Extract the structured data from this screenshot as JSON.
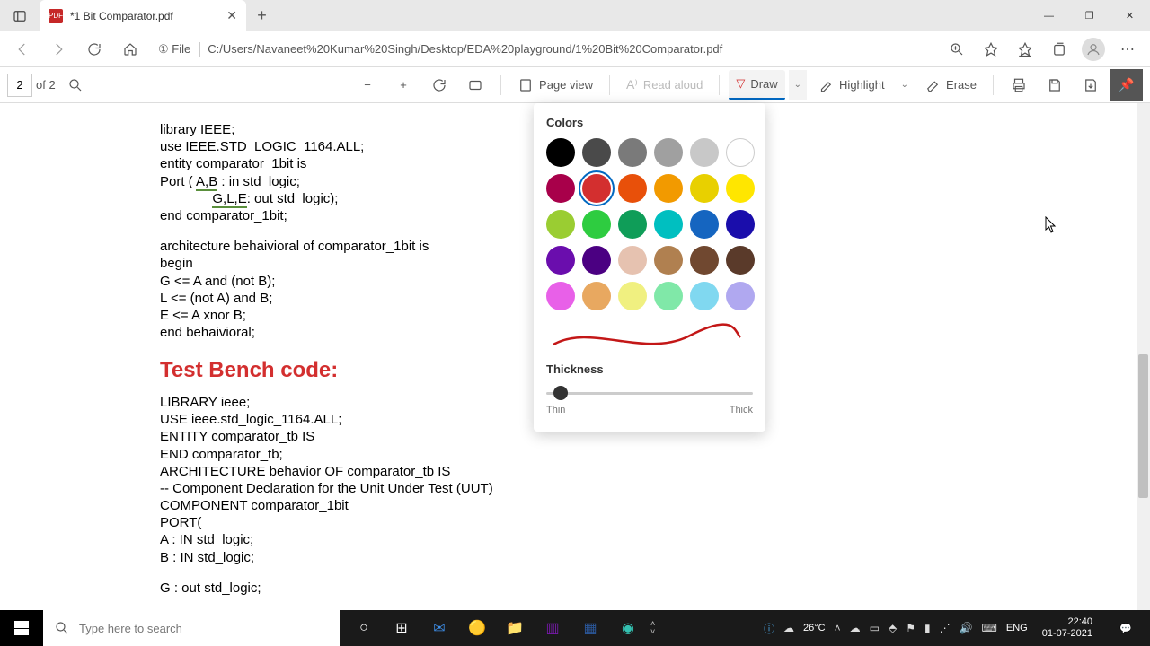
{
  "tab": {
    "title": "*1 Bit Comparator.pdf"
  },
  "url": {
    "scheme_label": "① File",
    "path": "C:/Users/Navaneet%20Kumar%20Singh/Desktop/EDA%20playground/1%20Bit%20Comparator.pdf"
  },
  "pdf_toolbar": {
    "page_current": "2",
    "page_total": "of 2",
    "page_view": "Page view",
    "read_aloud": "Read aloud",
    "draw": "Draw",
    "highlight": "Highlight",
    "erase": "Erase"
  },
  "draw_popup": {
    "colors_label": "Colors",
    "thickness_label": "Thickness",
    "thin": "Thin",
    "thick": "Thick",
    "selected_index": 7,
    "swatches": [
      "#000000",
      "#4a4a4a",
      "#7a7a7a",
      "#a0a0a0",
      "#c8c8c8",
      "#ffffff",
      "#a8004a",
      "#d32f2f",
      "#e8500a",
      "#f29a00",
      "#e8d000",
      "#ffe600",
      "#9acd32",
      "#2ecc40",
      "#0f9d58",
      "#00bfc0",
      "#1565c0",
      "#1a0dab",
      "#6a0dad",
      "#4b0082",
      "#e6c2b0",
      "#b08050",
      "#704830",
      "#5a3a2a",
      "#e860e8",
      "#e8a860",
      "#f0f080",
      "#80e8a8",
      "#80d8f0",
      "#b0a8f0"
    ]
  },
  "document": {
    "lines_top": [
      "library IEEE;",
      "use IEEE.STD_LOGIC_1164.ALL;",
      "entity comparator_1bit is"
    ],
    "port_line_1a": "    Port ( ",
    "port_line_1b": "A,B",
    "port_line_1c": " : in std_logic;",
    "port_line_2a": "              ",
    "port_line_2b": "G,L,E",
    "port_line_2c": ": out std_logic);",
    "lines_mid": [
      "end comparator_1bit;",
      "",
      "architecture behaivioral of comparator_1bit is",
      "   begin",
      "    G <= A and (not B);",
      "    L <= (not A) and B;",
      "    E <= A xnor B;",
      "end behaivioral;"
    ],
    "red_heading": "Test Bench code:",
    "lines_bottom": [
      "LIBRARY ieee;",
      " USE ieee.std_logic_1164.ALL;",
      " ENTITY comparator_tb IS",
      " END comparator_tb;",
      "  ARCHITECTURE behavior OF comparator_tb IS",
      "   -- Component Declaration for the Unit Under Test (UUT)",
      "   COMPONENT comparator_1bit",
      "   PORT(",
      "      A : IN std_logic;",
      "      B : IN std_logic;",
      "",
      "      G : out std_logic;"
    ]
  },
  "taskbar": {
    "search_placeholder": "Type here to search",
    "temp": "26°C",
    "lang": "ENG",
    "time": "22:40",
    "date": "01-07-2021"
  }
}
